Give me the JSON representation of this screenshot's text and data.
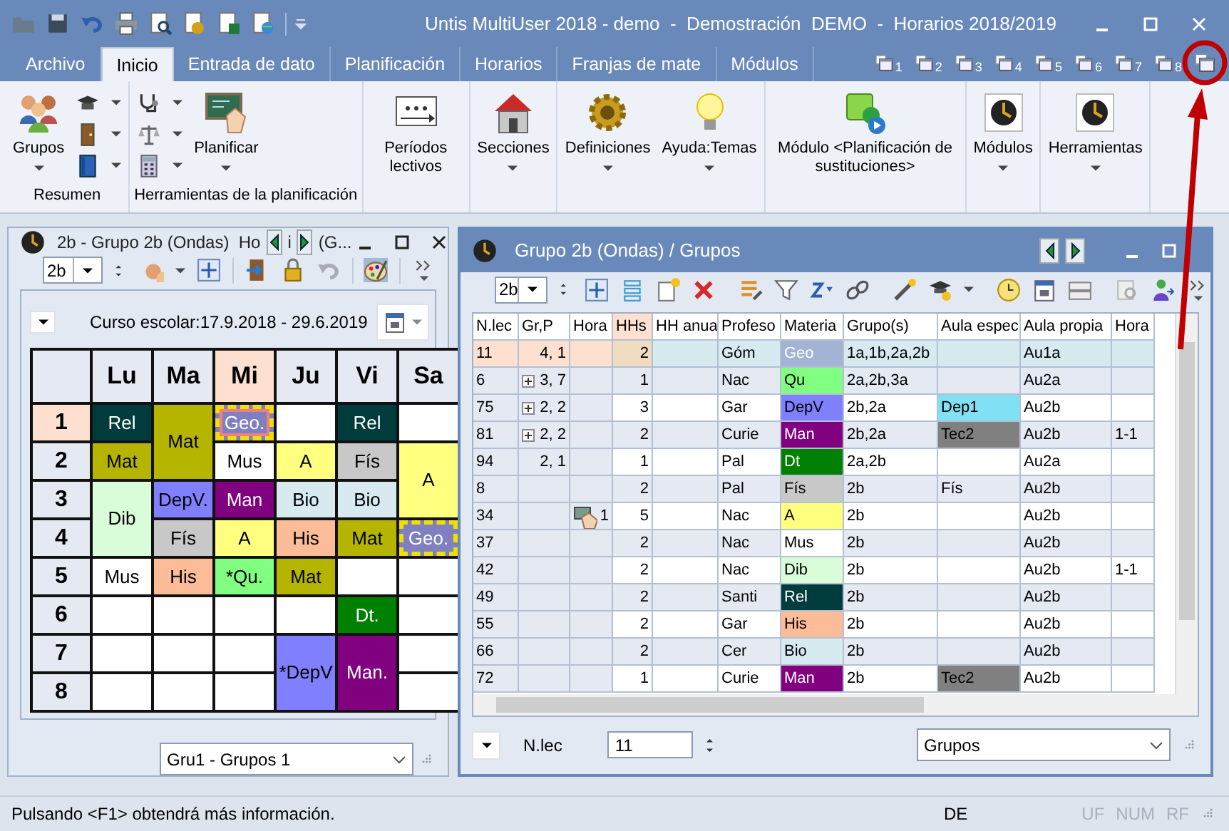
{
  "window": {
    "title": "Untis MultiUser 2018 - demo  -  Demostración  DEMO  -  Horarios 2018/2019"
  },
  "ribbon_tabs": [
    {
      "label": "Archivo",
      "selected": false
    },
    {
      "label": "Inicio",
      "selected": true
    },
    {
      "label": "Entrada de dato",
      "selected": false
    },
    {
      "label": "Planificación",
      "selected": false
    },
    {
      "label": "Horarios",
      "selected": false
    },
    {
      "label": "Franjas de mate",
      "selected": false
    },
    {
      "label": "Módulos",
      "selected": false
    }
  ],
  "window_slots": [
    "1",
    "2",
    "3",
    "4",
    "5",
    "6",
    "7",
    "8"
  ],
  "ribbon_groups": [
    {
      "label": "Resumen",
      "items": [
        {
          "kind": "large",
          "label": "Grupos",
          "dropdown": true
        },
        {
          "kind": "small",
          "dropdown": true
        },
        {
          "kind": "small",
          "dropdown": true
        },
        {
          "kind": "small",
          "dropdown": true
        }
      ]
    },
    {
      "label": "Herramientas de la planificación",
      "items": [
        {
          "kind": "small",
          "dropdown": true
        },
        {
          "kind": "small",
          "dropdown": true
        },
        {
          "kind": "small",
          "dropdown": true
        },
        {
          "kind": "large",
          "label": "Planificar",
          "dropdown": true
        }
      ]
    },
    {
      "items": [
        {
          "kind": "large",
          "label": "Períodos lectivos",
          "dropdown": false
        }
      ]
    },
    {
      "items": [
        {
          "kind": "large",
          "label": "Secciones",
          "dropdown": true
        }
      ]
    },
    {
      "items": [
        {
          "kind": "large",
          "label": "Definiciones",
          "dropdown": true
        },
        {
          "kind": "large",
          "label": "Ayuda:Temas",
          "dropdown": true
        }
      ]
    },
    {
      "items": [
        {
          "kind": "large",
          "label": "Módulo <Planificación de sustituciones>",
          "dropdown": false
        }
      ]
    },
    {
      "items": [
        {
          "kind": "large",
          "label": "Módulos",
          "dropdown": true
        }
      ]
    },
    {
      "items": [
        {
          "kind": "large",
          "label": "Herramientas",
          "dropdown": true
        }
      ]
    }
  ],
  "timetable_window": {
    "title_parts": [
      "2b - Grupo 2b (Ondas)  Ho",
      "i",
      "(G..."
    ],
    "class_field": "2b",
    "school_year": "Curso escolar:17.9.2018 - 29.6.2019",
    "days": [
      {
        "label": "Lu",
        "selected": false
      },
      {
        "label": "Ma",
        "selected": false
      },
      {
        "label": "Mi",
        "selected": true
      },
      {
        "label": "Ju",
        "selected": false
      },
      {
        "label": "Vi",
        "selected": false
      },
      {
        "label": "Sa",
        "selected": false
      }
    ],
    "periods": [
      {
        "label": "1",
        "selected": true
      },
      {
        "label": "2",
        "selected": false
      },
      {
        "label": "3",
        "selected": false
      },
      {
        "label": "4",
        "selected": false
      },
      {
        "label": "5",
        "selected": false
      },
      {
        "label": "6",
        "selected": false
      },
      {
        "label": "7",
        "selected": false
      },
      {
        "label": "8",
        "selected": false
      }
    ],
    "rows": [
      [
        {
          "kind": "lesson",
          "text": "Rel",
          "color": "#003c3c",
          "light_text": true,
          "marked": false
        },
        {
          "kind": "lesson",
          "text": "Mat",
          "color": "#b5b500",
          "light_text": false,
          "marked": false
        },
        {
          "kind": "lesson",
          "text": "Geo.",
          "color": "#8080c0",
          "light_text": true,
          "marked": true
        },
        {
          "kind": "empty"
        },
        {
          "kind": "lesson",
          "text": "Rel",
          "color": "#003c3c",
          "light_text": true,
          "marked": false
        },
        {
          "kind": "empty"
        }
      ],
      [
        {
          "kind": "lesson",
          "text": "Mat",
          "color": "#b5b500",
          "light_text": false,
          "marked": false
        },
        {
          "kind": "continued"
        },
        {
          "kind": "lesson",
          "text": "Mus",
          "color": "#ffffff",
          "light_text": false,
          "marked": false
        },
        {
          "kind": "lesson",
          "text": "A",
          "color": "#ffff80",
          "light_text": false,
          "marked": false
        },
        {
          "kind": "lesson",
          "text": "Fís",
          "color": "#c8c8c8",
          "light_text": false,
          "marked": false
        },
        {
          "kind": "lesson",
          "text": "A",
          "color": "#ffff80",
          "light_text": false,
          "marked": false
        }
      ],
      [
        {
          "kind": "lesson",
          "text": "Dib",
          "color": "#d9fcd9",
          "light_text": false,
          "marked": false
        },
        {
          "kind": "lesson",
          "text": "DepV.",
          "color": "#8080ff",
          "light_text": false,
          "marked": false
        },
        {
          "kind": "lesson",
          "text": "Man",
          "color": "#800080",
          "light_text": true,
          "marked": false
        },
        {
          "kind": "lesson",
          "text": "Bio",
          "color": "#d6eaf0",
          "light_text": false,
          "marked": false
        },
        {
          "kind": "lesson",
          "text": "Bio",
          "color": "#d6eaf0",
          "light_text": false,
          "marked": false
        },
        {
          "kind": "continued"
        }
      ],
      [
        {
          "kind": "continued"
        },
        {
          "kind": "lesson",
          "text": "Fís",
          "color": "#c8c8c8",
          "light_text": false,
          "marked": false
        },
        {
          "kind": "lesson",
          "text": "A",
          "color": "#ffff80",
          "light_text": false,
          "marked": false
        },
        {
          "kind": "lesson",
          "text": "His",
          "color": "#fcbc98",
          "light_text": false,
          "marked": false
        },
        {
          "kind": "lesson",
          "text": "Mat",
          "color": "#b5b500",
          "light_text": false,
          "marked": false
        },
        {
          "kind": "lesson",
          "text": "Geo.",
          "color": "#8080c0",
          "light_text": true,
          "marked": true
        }
      ],
      [
        {
          "kind": "lesson",
          "text": "Mus",
          "color": "#ffffff",
          "light_text": false,
          "marked": false
        },
        {
          "kind": "lesson",
          "text": "His",
          "color": "#fcbc98",
          "light_text": false,
          "marked": false
        },
        {
          "kind": "lesson",
          "text": "*Qu.",
          "color": "#80ff80",
          "light_text": false,
          "marked": false
        },
        {
          "kind": "lesson",
          "text": "Mat",
          "color": "#b5b500",
          "light_text": false,
          "marked": false
        },
        {
          "kind": "empty"
        },
        {
          "kind": "empty"
        }
      ],
      [
        {
          "kind": "empty"
        },
        {
          "kind": "empty"
        },
        {
          "kind": "empty"
        },
        {
          "kind": "empty"
        },
        {
          "kind": "lesson",
          "text": "Dt.",
          "color": "#008000",
          "light_text": true,
          "marked": false
        },
        {
          "kind": "empty"
        }
      ],
      [
        {
          "kind": "empty"
        },
        {
          "kind": "empty"
        },
        {
          "kind": "empty"
        },
        {
          "kind": "lesson",
          "text": "*DepV",
          "color": "#8080ff",
          "light_text": false,
          "marked": false
        },
        {
          "kind": "lesson",
          "text": "Man.",
          "color": "#800080",
          "light_text": true,
          "marked": false
        },
        {
          "kind": "empty"
        }
      ],
      [
        {
          "kind": "empty"
        },
        {
          "kind": "empty"
        },
        {
          "kind": "empty"
        },
        {
          "kind": "continued"
        },
        {
          "kind": "continued"
        },
        {
          "kind": "empty"
        }
      ]
    ],
    "selector": "Gru1 - Grupos 1"
  },
  "lessons_window": {
    "title": "Grupo 2b (Ondas) / Grupos",
    "class_field": "2b",
    "columns": [
      "N.lec",
      "Gr,P",
      "Hora",
      "HHs",
      "HH anua",
      "Profeso",
      "Materia",
      "Grupo(s)",
      "Aula espec",
      "Aula propia",
      "Hora"
    ],
    "rows": [
      {
        "selected": true,
        "expandable": false,
        "n_lec": "11",
        "gr_p": "4, 1",
        "hhs": "2",
        "teacher": "Góm",
        "subject": {
          "text": "Geo",
          "color": "#a3b3d3",
          "light_text": true
        },
        "groups": "1a,1b,2a,2b",
        "own_room": "Au1a"
      },
      {
        "selected": false,
        "expandable": true,
        "n_lec": "6",
        "gr_p": "3, 7",
        "hhs": "1",
        "teacher": "Nac",
        "subject": {
          "text": "Qu",
          "color": "#80ff80",
          "light_text": false
        },
        "groups": "2a,2b,3a",
        "own_room": "Au2a"
      },
      {
        "selected": false,
        "expandable": true,
        "n_lec": "75",
        "gr_p": "2, 2",
        "hhs": "3",
        "teacher": "Gar",
        "subject": {
          "text": "DepV",
          "color": "#8080ff",
          "light_text": false
        },
        "groups": "2b,2a",
        "special_room": {
          "text": "Dep1",
          "color": "#80e0f4"
        },
        "own_room": "Au2b"
      },
      {
        "selected": false,
        "expandable": true,
        "n_lec": "81",
        "gr_p": "2, 2",
        "hhs": "2",
        "teacher": "Curie",
        "subject": {
          "text": "Man",
          "color": "#800080",
          "light_text": true
        },
        "groups": "2b,2a",
        "special_room": {
          "text": "Tec2",
          "color": "#808080"
        },
        "own_room": "Au2b",
        "period": "1-1"
      },
      {
        "selected": false,
        "expandable": false,
        "n_lec": "94",
        "gr_p": "2, 1",
        "hhs": "1",
        "teacher": "Pal",
        "subject": {
          "text": "Dt",
          "color": "#008000",
          "light_text": true
        },
        "groups": "2a,2b",
        "own_room": "Au2a"
      },
      {
        "selected": false,
        "expandable": false,
        "n_lec": "8",
        "hhs": "2",
        "teacher": "Pal",
        "subject": {
          "text": "Fís",
          "color": "#c8c8c8",
          "light_text": false
        },
        "groups": "2b",
        "special_room": {
          "text": "Fís"
        },
        "own_room": "Au2b"
      },
      {
        "selected": false,
        "expandable": false,
        "n_lec": "34",
        "hours": "1",
        "hhs": "5",
        "teacher": "Nac",
        "subject": {
          "text": "A",
          "color": "#ffff80",
          "light_text": false
        },
        "groups": "2b",
        "own_room": "Au2b"
      },
      {
        "selected": false,
        "expandable": false,
        "n_lec": "37",
        "hhs": "2",
        "teacher": "Nac",
        "subject": {
          "text": "Mus",
          "color": "#ffffff",
          "light_text": false
        },
        "groups": "2b",
        "own_room": "Au2b"
      },
      {
        "selected": false,
        "expandable": false,
        "n_lec": "42",
        "hhs": "2",
        "teacher": "Nac",
        "subject": {
          "text": "Dib",
          "color": "#d9fcd9",
          "light_text": false
        },
        "groups": "2b",
        "own_room": "Au2b",
        "period": "1-1"
      },
      {
        "selected": false,
        "expandable": false,
        "n_lec": "49",
        "hhs": "2",
        "teacher": "Santi",
        "subject": {
          "text": "Rel",
          "color": "#003c3c",
          "light_text": true
        },
        "groups": "2b",
        "own_room": "Au2b"
      },
      {
        "selected": false,
        "expandable": false,
        "n_lec": "55",
        "hhs": "2",
        "teacher": "Gar",
        "subject": {
          "text": "His",
          "color": "#fcbc98",
          "light_text": false
        },
        "groups": "2b",
        "own_room": "Au2b"
      },
      {
        "selected": false,
        "expandable": false,
        "n_lec": "66",
        "hhs": "2",
        "teacher": "Cer",
        "subject": {
          "text": "Bio",
          "color": "#d6eaf0",
          "light_text": false
        },
        "groups": "2b",
        "own_room": "Au2b"
      },
      {
        "selected": false,
        "expandable": false,
        "n_lec": "72",
        "hhs": "1",
        "teacher": "Curie",
        "subject": {
          "text": "Man",
          "color": "#800080",
          "light_text": true
        },
        "groups": "2b",
        "special_room": {
          "text": "Tec2",
          "color": "#808080"
        },
        "own_room": "Au2b"
      }
    ],
    "footer": {
      "label": "N.lec",
      "value": "11",
      "view": "Grupos"
    }
  },
  "status_bar": {
    "message": "Pulsando <F1> obtendrá más información.",
    "language": "DE",
    "indicators": [
      {
        "label": "UF",
        "on": false
      },
      {
        "label": "NUM",
        "on": false
      },
      {
        "label": "RF",
        "on": false
      }
    ]
  }
}
